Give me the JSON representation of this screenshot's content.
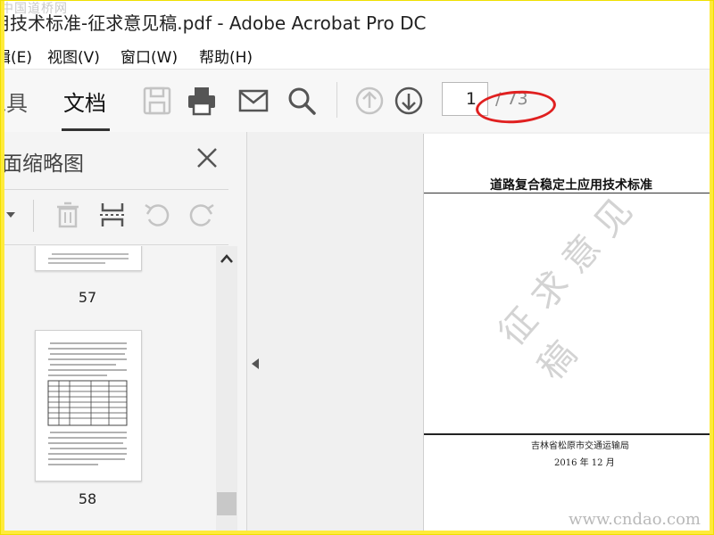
{
  "window": {
    "title": "应用技术标准-征求意见稿.pdf - Adobe Acrobat Pro DC",
    "title_visible": "应用技术标准-征求意见稿.pdf - Adobe Acrobat Pro DC"
  },
  "watermarks": {
    "top_left": "中国道桥网",
    "bottom_right": "www.cndao.com"
  },
  "menu": {
    "items": [
      "辑(E)",
      "视图(V)",
      "窗口(W)",
      "帮助(H)"
    ]
  },
  "toolbar": {
    "tabs": [
      {
        "label": "工具",
        "active": false
      },
      {
        "label": "文档",
        "active": true
      }
    ],
    "icons": [
      "save-icon",
      "print-icon",
      "email-icon",
      "search-icon",
      "page-up-icon",
      "page-down-icon"
    ],
    "current_page": "1",
    "total_pages": "/ 73",
    "annotation_color": "#e02020"
  },
  "sidebar": {
    "title": "页面缩略图",
    "tools": [
      "options-dropdown-icon",
      "delete-icon",
      "split-icon",
      "rotate-counterclockwise-icon",
      "rotate-clockwise-icon"
    ],
    "thumbnails": [
      {
        "label": "57"
      },
      {
        "label": "58"
      }
    ]
  },
  "document": {
    "title": "道路复合稳定土应用技术标准",
    "watermark": "征求意见稿",
    "publisher": "吉林省松原市交通运输局",
    "date": "2016 年 12 月"
  },
  "colors": {
    "accent": "#333333",
    "frame": "#ffeb3b",
    "icon_active": "#555555",
    "icon_disabled": "#c4c4c4"
  }
}
